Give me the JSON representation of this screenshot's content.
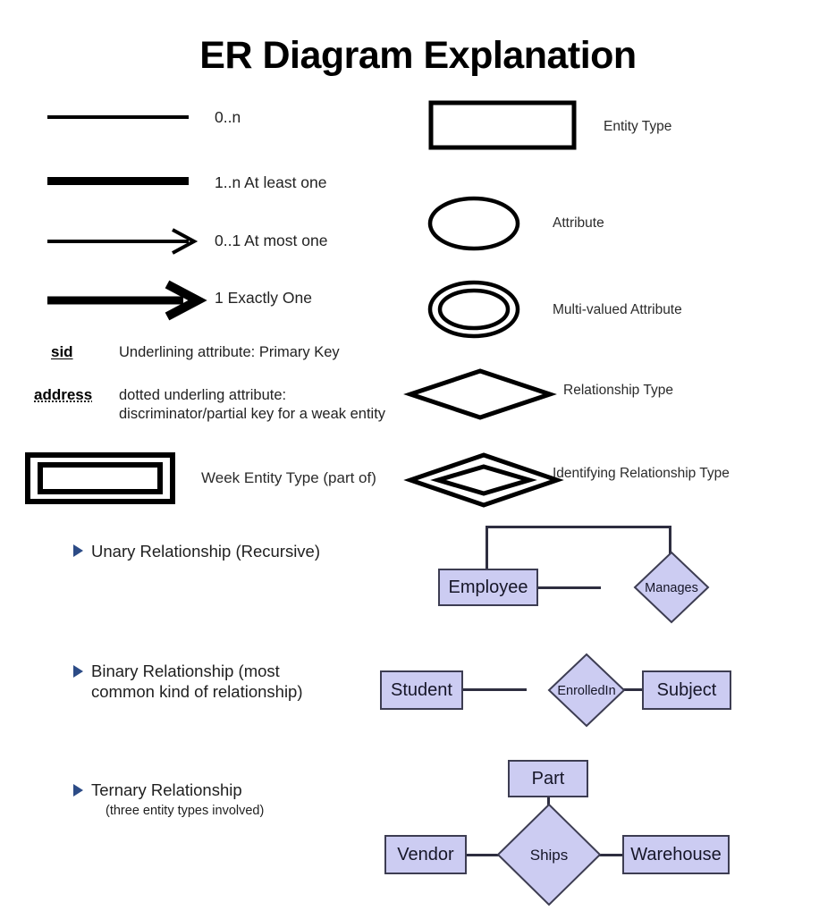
{
  "title": "ER Diagram Explanation",
  "cardinality_legend": [
    {
      "symbol": "plain-line",
      "label": "0..n"
    },
    {
      "symbol": "thick-line",
      "label": "1..n At least one"
    },
    {
      "symbol": "thin-arrow",
      "label": "0..1 At most one"
    },
    {
      "symbol": "thick-arrow",
      "label": "1 Exactly One"
    }
  ],
  "key_legend": [
    {
      "term": "sid",
      "underline": "solid",
      "description": "Underlining attribute: Primary Key"
    },
    {
      "term": "address",
      "underline": "dotted",
      "description": "dotted underling attribute:\ndiscriminator/partial key for a weak entity"
    }
  ],
  "weak_entity": {
    "label": "Week Entity Type (part of)"
  },
  "shape_legend": [
    {
      "shape": "rectangle",
      "label": "Entity Type"
    },
    {
      "shape": "ellipse",
      "label": "Attribute"
    },
    {
      "shape": "double-ellipse",
      "label": "Multi-valued Attribute"
    },
    {
      "shape": "diamond",
      "label": "Relationship Type"
    },
    {
      "shape": "double-diamond",
      "label": "Identifying Relationship Type"
    }
  ],
  "examples": [
    {
      "id": "unary",
      "bullet": "Unary Relationship (Recursive)",
      "sub": "",
      "entities": [
        "Employee"
      ],
      "relationship": "Manages"
    },
    {
      "id": "binary",
      "bullet": "Binary Relationship (most\ncommon kind of relationship)",
      "sub": "",
      "entities": [
        "Student",
        "Subject"
      ],
      "relationship": "EnrolledIn"
    },
    {
      "id": "ternary",
      "bullet": "Ternary Relationship",
      "sub": "(three entity types involved)",
      "entities": [
        "Part",
        "Vendor",
        "Warehouse"
      ],
      "relationship": "Ships"
    }
  ],
  "colors": {
    "entity_fill": "#ccccf2",
    "entity_stroke": "#3d3d52",
    "bullet": "#2c4b86",
    "ink": "#000000"
  }
}
